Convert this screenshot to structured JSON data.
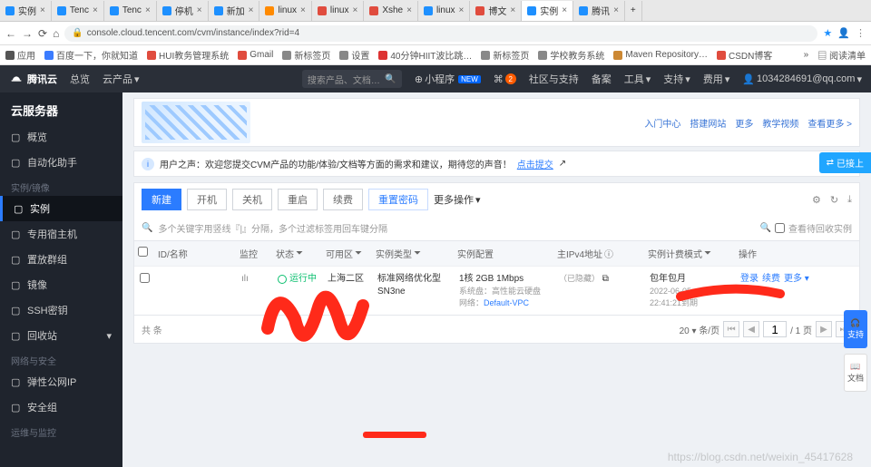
{
  "browser": {
    "tabs": [
      {
        "label": "实例",
        "fav": "#1e90ff"
      },
      {
        "label": "Tenc",
        "fav": "#1e90ff"
      },
      {
        "label": "Tenc",
        "fav": "#1e90ff"
      },
      {
        "label": "停机",
        "fav": "#1e90ff"
      },
      {
        "label": "新加",
        "fav": "#1e90ff"
      },
      {
        "label": "linux",
        "fav": "#ff8a00"
      },
      {
        "label": "linux",
        "fav": "#e04c3e"
      },
      {
        "label": "Xshe",
        "fav": "#e04c3e"
      },
      {
        "label": "linux",
        "fav": "#1e90ff"
      },
      {
        "label": "博文",
        "fav": "#e04c3e"
      },
      {
        "label": "实例",
        "fav": "#1e90ff",
        "active": true
      },
      {
        "label": "腾讯",
        "fav": "#1e90ff"
      }
    ],
    "url": "console.cloud.tencent.com/cvm/instance/index?rid=4",
    "star_color": "#1e90ff",
    "reading_list": "阅读清单"
  },
  "bookmarks": [
    {
      "label": "应用",
      "color": "#555"
    },
    {
      "label": "百度一下，你就知道",
      "color": "#3b7cff"
    },
    {
      "label": "HUI教务管理系统",
      "color": "#e04c3e"
    },
    {
      "label": "Gmail",
      "color": "#e04c3e"
    },
    {
      "label": "新标签页",
      "color": "#888"
    },
    {
      "label": "设置",
      "color": "#888"
    },
    {
      "label": "40分钟HIIT波比跳…",
      "color": "#d33"
    },
    {
      "label": "新标签页",
      "color": "#888"
    },
    {
      "label": "学校教务系统",
      "color": "#888"
    },
    {
      "label": "Maven Repository…",
      "color": "#c83"
    },
    {
      "label": "CSDN博客",
      "color": "#e04c3e"
    }
  ],
  "topnav": {
    "brand": "腾讯云",
    "menu": [
      "总览",
      "云产品"
    ],
    "search_ph": "搜索产品、文档…",
    "items": [
      "小程序",
      "",
      "社区与支持",
      "备案",
      "工具",
      "支持",
      "费用"
    ],
    "badge": "2",
    "user": "1034284691@qq.com"
  },
  "sidebar": {
    "title": "云服务器",
    "groups": [
      {
        "label": "",
        "items": [
          {
            "icon": "grid",
            "label": "概览"
          },
          {
            "icon": "robot",
            "label": "自动化助手"
          }
        ]
      },
      {
        "label": "实例/镜像",
        "items": [
          {
            "icon": "cube",
            "label": "实例",
            "active": true
          },
          {
            "icon": "host",
            "label": "专用宿主机"
          },
          {
            "icon": "place",
            "label": "置放群组"
          },
          {
            "icon": "image",
            "label": "镜像"
          },
          {
            "icon": "key",
            "label": "SSH密钥"
          },
          {
            "icon": "trash",
            "label": "回收站",
            "chev": true
          }
        ]
      },
      {
        "label": "网络与安全",
        "items": [
          {
            "icon": "ip",
            "label": "弹性公网IP"
          },
          {
            "icon": "shield",
            "label": "安全组"
          }
        ]
      },
      {
        "label": "运维与监控",
        "items": []
      }
    ]
  },
  "banner": {
    "links": [
      "入门中心",
      "搭建网站",
      "更多",
      "教学视频",
      "查看更多 >"
    ]
  },
  "switch_btn": "已接上",
  "notice": {
    "text": "用户之声：欢迎您提交CVM产品的功能/体验/文档等方面的需求和建议，期待您的声音！",
    "link": "点击提交",
    "nav": [
      "‹",
      "›",
      "×"
    ]
  },
  "toolbar": {
    "primary": "新建",
    "btns": [
      "开机",
      "关机",
      "重启",
      "续费",
      "重置密码"
    ],
    "more": "更多操作",
    "right_icons": [
      "⚙",
      "↻",
      "⤓"
    ]
  },
  "searchrow": {
    "placeholder": "多个关键字用竖线『|』分隔，多个过滤标签用回车键分隔",
    "checkbox_label": "查看待回收实例"
  },
  "table": {
    "headers": [
      "",
      "ID/名称",
      "监控",
      "状态",
      "可用区",
      "实例类型",
      "实例配置",
      "主IPv4地址",
      "实例计费模式",
      "操作"
    ],
    "row": {
      "monitor": "ılı",
      "status": "运行中",
      "zone": "上海二区",
      "type_line1": "标准网络优化型",
      "type_line2": "SN3ne",
      "cfg_line1": "1核 2GB 1Mbps",
      "cfg_line2": "系统盘：高性能云硬盘",
      "cfg_line3": "网络：",
      "cfg_link": "Default-VPC",
      "bill_line1": "包年包月",
      "bill_line2": "2022-06-05",
      "bill_line3": "22:41:21到期",
      "actions": [
        "登录",
        "续费",
        "更多"
      ]
    }
  },
  "pager": {
    "summary": "共",
    "per_page": "20",
    "per_label": "条/页",
    "page": "1",
    "total_pages": "/ 1 页"
  },
  "float": {
    "a": "支持",
    "b": "文档"
  },
  "watermark": "https://blog.csdn.net/weixin_45417628"
}
